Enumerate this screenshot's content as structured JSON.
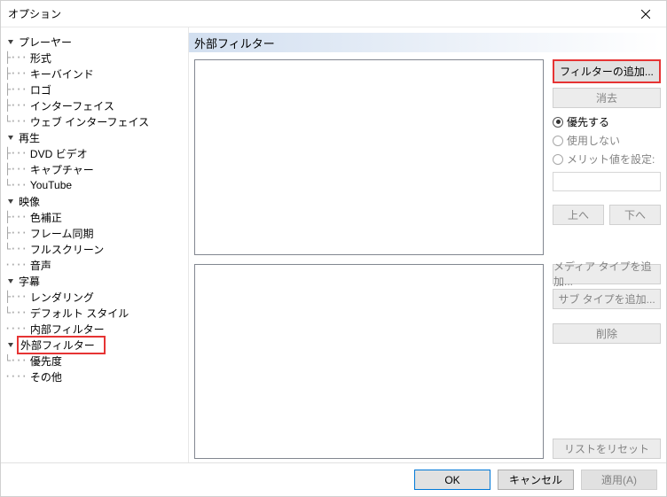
{
  "titlebar": {
    "title": "オプション"
  },
  "tree": {
    "player": {
      "label": "プレーヤー",
      "fmt": "形式",
      "keybind": "キーバインド",
      "logo": "ロゴ",
      "interface": "インターフェイス",
      "webif": "ウェブ インターフェイス"
    },
    "playback": {
      "label": "再生",
      "dvd": "DVD ビデオ",
      "capture": "キャプチャー",
      "youtube": "YouTube"
    },
    "video": {
      "label": "映像",
      "color": "色補正",
      "framesync": "フレーム同期",
      "fullscreen": "フルスクリーン"
    },
    "audio": {
      "label": "音声"
    },
    "subs": {
      "label": "字幕",
      "render": "レンダリング",
      "defstyle": "デフォルト スタイル"
    },
    "internal": {
      "label": "内部フィルター"
    },
    "external": {
      "label": "外部フィルター",
      "priority": "優先度"
    },
    "other": {
      "label": "その他"
    }
  },
  "content": {
    "header": "外部フィルター",
    "buttons": {
      "add_filter": "フィルターの追加...",
      "remove": "消去",
      "up": "上へ",
      "down": "下へ",
      "add_media": "メディア タイプを追加...",
      "add_sub": "サブ タイプを追加...",
      "delete": "削除",
      "reset": "リストをリセット"
    },
    "radios": {
      "prefer": "優先する",
      "dontuse": "使用しない",
      "merit": "メリット値を設定:"
    }
  },
  "footer": {
    "ok": "OK",
    "cancel": "キャンセル",
    "apply": "適用(A)"
  }
}
